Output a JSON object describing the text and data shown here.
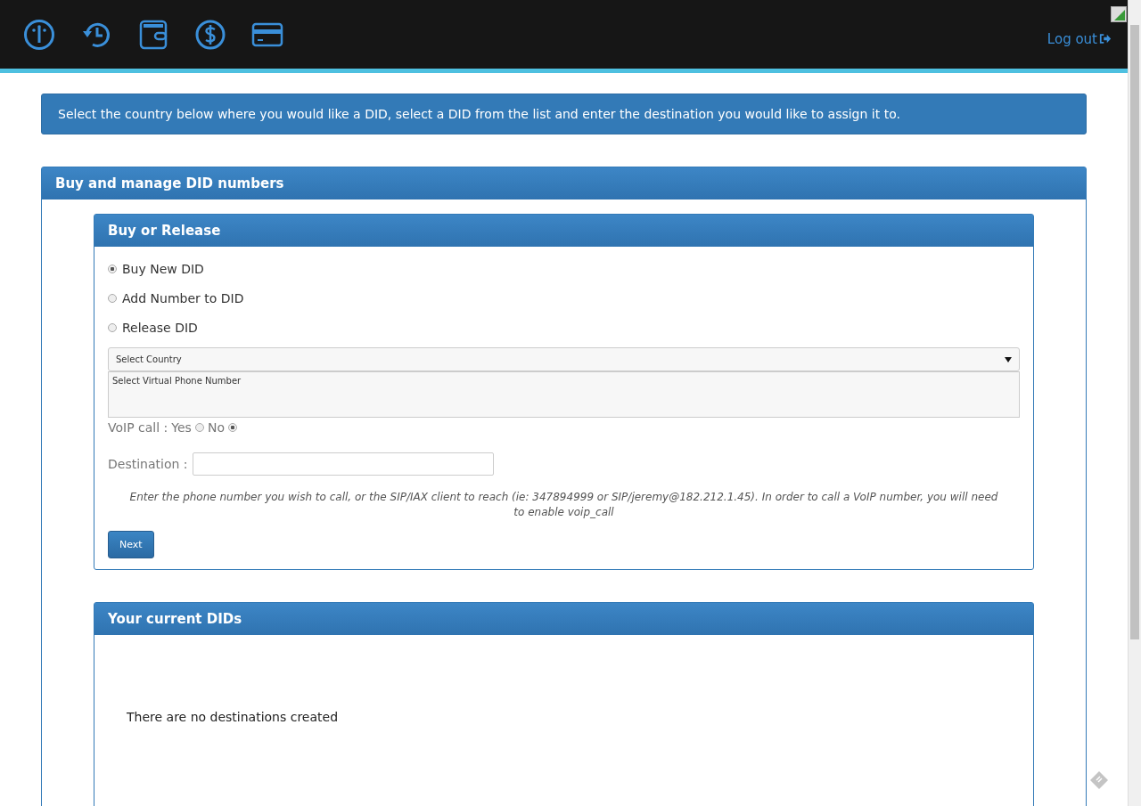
{
  "nav": {
    "icons": [
      {
        "kind": "gauge"
      },
      {
        "kind": "history"
      },
      {
        "kind": "wallet"
      },
      {
        "kind": "dollar"
      },
      {
        "kind": "card"
      }
    ],
    "logout": "Log out"
  },
  "info": "Select the country below where you would like a DID, select a DID from the list and enter the destination you would like to assign it to.",
  "panel": {
    "title": "Buy and manage DID numbers",
    "buy_or_release": {
      "title": "Buy or Release",
      "options": [
        {
          "label": "Buy New DID",
          "selected": true
        },
        {
          "label": "Add Number to DID",
          "selected": false
        },
        {
          "label": "Release DID",
          "selected": false
        }
      ],
      "country_select": {
        "value": "Select Country"
      },
      "number_list": {
        "placeholder": "Select Virtual Phone Number"
      },
      "voip": {
        "label": "VoIP call :",
        "options": [
          {
            "label": "Yes",
            "selected": false
          },
          {
            "label": "No",
            "selected": true
          }
        ]
      },
      "destination": {
        "label": "Destination :"
      },
      "hint": "Enter the phone number you wish to call, or the SIP/IAX client to reach (ie: 347894999 or SIP/jeremy@182.212.1.45). In order to call a VoIP number, you will need to enable voip_call",
      "next": "Next"
    },
    "current": {
      "title": "Your current DIDs",
      "empty": "There are no destinations created"
    }
  }
}
